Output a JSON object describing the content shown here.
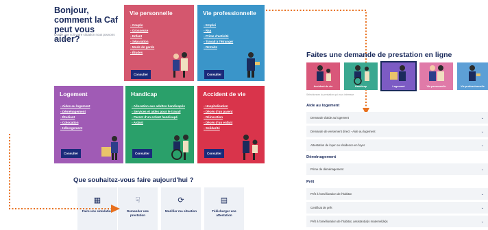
{
  "header": {
    "title": "Bonjour, comment la Caf peut vous aider?",
    "subtitle": "Quelle que soit votre situation nous pouvons vous aider"
  },
  "cards": [
    {
      "title": "Vie personnelle",
      "color": "#d4576e",
      "links": [
        "Couple",
        "Grossesse",
        "Enfant",
        "Séparation",
        "Mode de garde",
        "Études"
      ],
      "button": "Consulter"
    },
    {
      "title": "Vie professionnelle",
      "color": "#3a95c9",
      "links": [
        "Emploi",
        "Rsa",
        "Prime d'activité",
        "Travail à l'étranger",
        "Retraite"
      ],
      "button": "Consulter"
    },
    {
      "title": "Logement",
      "color": "#a05bb5",
      "links": [
        "Aides au logement",
        "Déménagement",
        "Étudiant",
        "Colocation",
        "Hébergement"
      ],
      "button": "Consulter"
    },
    {
      "title": "Handicap",
      "color": "#2aa06a",
      "links": [
        "Allocation aux adultes handicapés",
        "Services et aides pour le travail",
        "Parent d'un enfant handicapé",
        "Aidant"
      ],
      "button": "Consulter"
    },
    {
      "title": "Accident de vie",
      "color": "#d9344b",
      "links": [
        "Hospitalisation",
        "Décès d'un parent",
        "Réinsertion",
        "Décès d'un enfant",
        "Solidarité"
      ],
      "button": "Consulter"
    }
  ],
  "quick": {
    "title": "Que souhaitez-vous faire aujourd'hui ?",
    "items": [
      {
        "icon": "calculator-icon",
        "label": "Faire une simulation"
      },
      {
        "icon": "hand-request-icon",
        "label": "Demander une prestation"
      },
      {
        "icon": "refresh-icon",
        "label": "Modifier ma situation"
      },
      {
        "icon": "document-icon",
        "label": "Télécharger une attestation"
      }
    ]
  },
  "right": {
    "title": "Faites une demande de prestation en ligne",
    "tabs": [
      {
        "label": "Accident de vie",
        "color": "#d9587a"
      },
      {
        "label": "Handicap",
        "color": "#3aa890"
      },
      {
        "label": "Logement",
        "color": "#7c5bc4"
      },
      {
        "label": "Vie personnelle",
        "color": "#e07aa8"
      },
      {
        "label": "Vie professionnelle",
        "color": "#5d9fd6"
      }
    ],
    "hint": "Sélectionnez la prestation qui vous intéresse",
    "sections": [
      {
        "title": "Aide au logement",
        "rows": [
          "Demande d'aide au logement",
          "Demande de versement direct - Aide au logement",
          "Attestation de loyer ou résidence en foyer"
        ]
      },
      {
        "title": "Déménagement",
        "rows": [
          "Prime de déménagement"
        ]
      },
      {
        "title": "Prêt",
        "rows": [
          "Prêt à l'amélioration de l'habitat",
          "Certificat de prêt",
          "Prêt à l'amélioration de l'habitat, assistant(e)s maternel(le)s"
        ]
      }
    ]
  },
  "colors": {
    "arrow": "#e8701e",
    "navy": "#1b2b5c",
    "button": "#1a2a7a"
  }
}
